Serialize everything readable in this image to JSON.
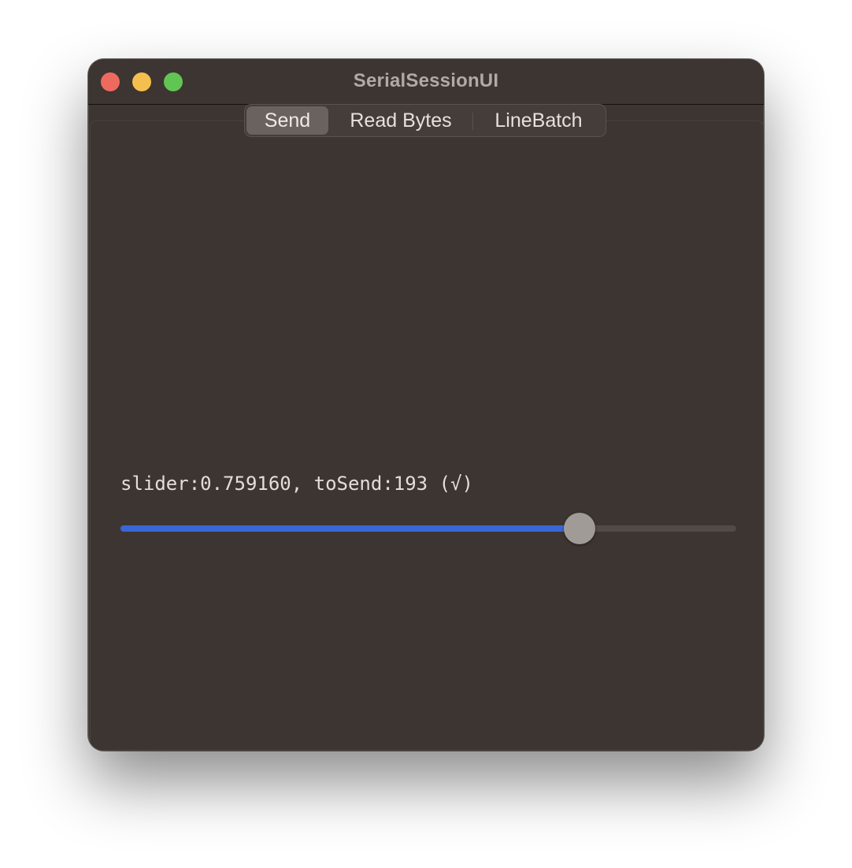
{
  "window": {
    "title": "SerialSessionUI"
  },
  "tabs": [
    {
      "label": "Send",
      "selected": true
    },
    {
      "label": "Read Bytes",
      "selected": false
    },
    {
      "label": "LineBatch",
      "selected": false
    }
  ],
  "send": {
    "status_text": "slider:0.759160, toSend:193 (√)",
    "slider_value": 0.75916
  },
  "colors": {
    "window_bg": "#3d3531",
    "accent": "#3a67d6",
    "close": "#ee6a5e",
    "minimize": "#f5bf4f",
    "zoom": "#61c554"
  }
}
